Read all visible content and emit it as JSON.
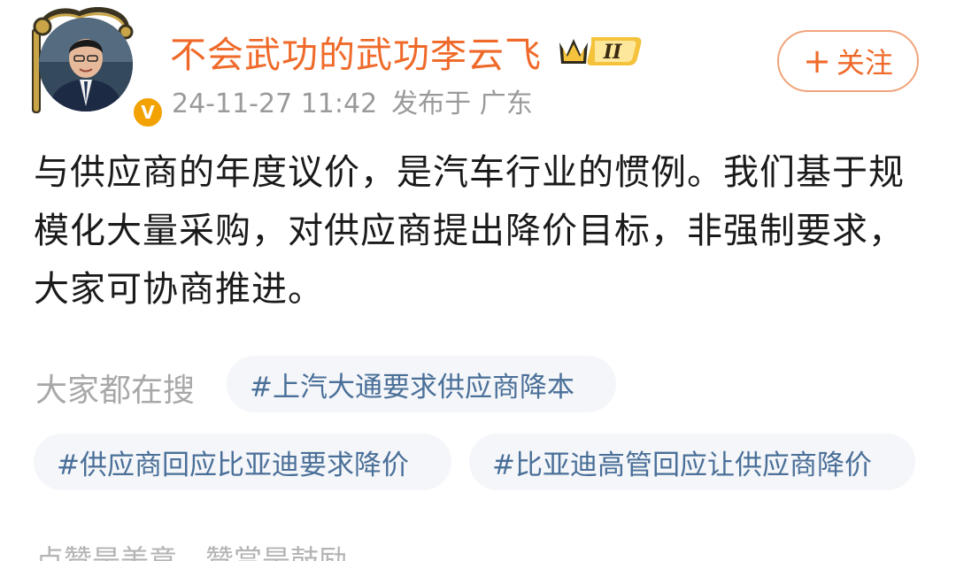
{
  "header": {
    "username": "不会武功的武功李云飞",
    "level_badge": "II",
    "verified_mark": "V",
    "timestamp": "24-11-27 11:42",
    "source": "发布于 广东",
    "follow_label": "关注",
    "follow_icon": "plus-icon"
  },
  "post": {
    "text": "与供应商的年度议价，是汽车行业的惯例。我们基于规模化大量采购，对供应商提出降价目标，非强制要求，大家可协商推进。"
  },
  "hot_search": {
    "label": "大家都在搜",
    "tags": [
      "#上汽大通要求供应商降本",
      "#供应商回应比亚迪要求降价",
      "#比亚迪高管回应让供应商降价"
    ]
  },
  "footer": {
    "text": "点赞是美意，赞赏是鼓励"
  },
  "colors": {
    "username": "#ef6a2a",
    "follow_border": "#f2a37b",
    "meta": "#9a9a9a",
    "tag_text": "#4a6f98",
    "tag_bg": "#f4f6f9",
    "verified": "#f2a202"
  }
}
